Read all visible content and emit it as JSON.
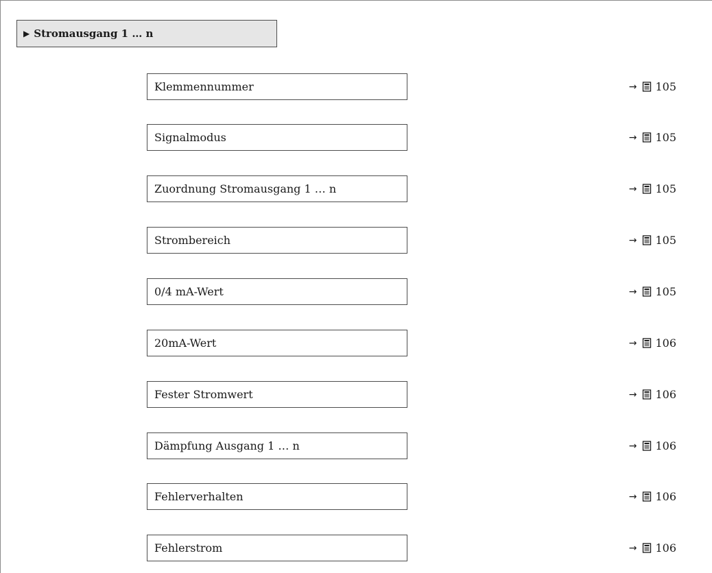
{
  "header": {
    "label": "Stromausgang 1 … n"
  },
  "parameters": [
    {
      "label": "Klemmennummer",
      "page": "105"
    },
    {
      "label": "Signalmodus",
      "page": "105"
    },
    {
      "label": "Zuordnung Stromausgang 1 … n",
      "page": "105"
    },
    {
      "label": "Strombereich",
      "page": "105"
    },
    {
      "label": "0/4 mA-Wert",
      "page": "105"
    },
    {
      "label": "20mA-Wert",
      "page": "106"
    },
    {
      "label": "Fester Stromwert",
      "page": "106"
    },
    {
      "label": "Dämpfung Ausgang 1 … n",
      "page": "106"
    },
    {
      "label": "Fehlerverhalten",
      "page": "106"
    },
    {
      "label": "Fehlerstrom",
      "page": "106"
    }
  ]
}
